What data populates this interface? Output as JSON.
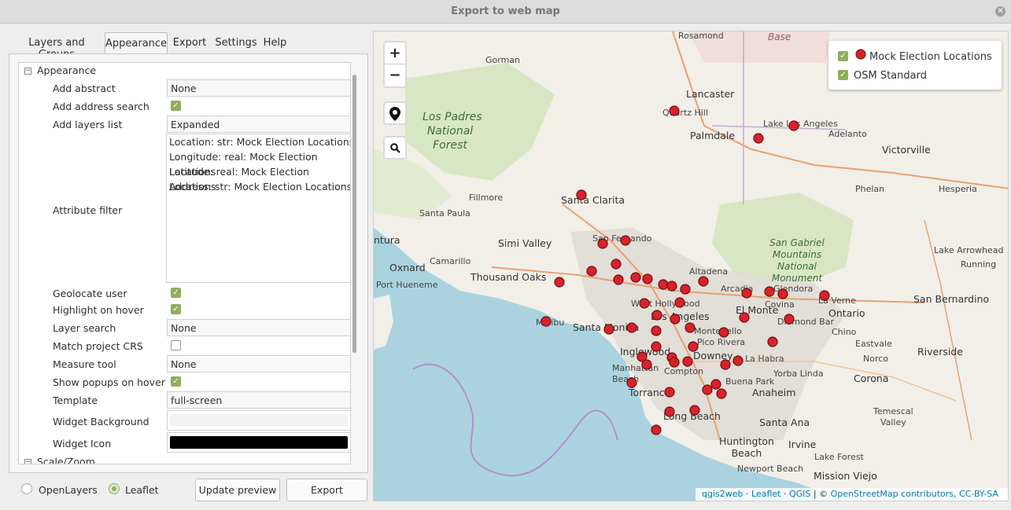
{
  "window": {
    "title": "Export to web map"
  },
  "tabs": [
    {
      "label": "Layers and Groups"
    },
    {
      "label": "Appearance"
    },
    {
      "label": "Export"
    },
    {
      "label": "Settings"
    },
    {
      "label": "Help"
    }
  ],
  "appearance": {
    "group_title": "Appearance",
    "toggle_collapse": "−",
    "add_abstract": {
      "label": "Add abstract",
      "value": "None"
    },
    "add_address_search": {
      "label": "Add address search",
      "checked": true
    },
    "add_layers_list": {
      "label": "Add layers list",
      "value": "Expanded"
    },
    "attribute_filter": {
      "label": "Attribute filter",
      "items": [
        "Location: str: Mock Election Locations",
        "Longitude: real: Mock Election Locations",
        "Latitude: real: Mock Election Locations",
        "Address: str: Mock Election Locations"
      ]
    },
    "geolocate_user": {
      "label": "Geolocate user",
      "checked": true
    },
    "highlight_on_hover": {
      "label": "Highlight on hover",
      "checked": true
    },
    "layer_search": {
      "label": "Layer search",
      "value": "None"
    },
    "match_project_crs": {
      "label": "Match project CRS",
      "checked": false
    },
    "measure_tool": {
      "label": "Measure tool",
      "value": "None"
    },
    "show_popups_on_hover": {
      "label": "Show popups on hover",
      "checked": true
    },
    "template": {
      "label": "Template",
      "value": "full-screen"
    },
    "widget_background": {
      "label": "Widget Background",
      "color": "#f2f2f2"
    },
    "widget_icon": {
      "label": "Widget Icon",
      "color": "#000000"
    },
    "scale_zoom_title": "Scale/Zoom"
  },
  "bottom": {
    "openlayers": "OpenLayers",
    "leaflet": "Leaflet",
    "selected": "Leaflet",
    "update_preview": "Update preview",
    "export": "Export"
  },
  "map": {
    "zoom_in": "+",
    "zoom_out": "−",
    "legend": [
      {
        "label": "Mock Election Locations",
        "marker_color": "#d9222a"
      },
      {
        "label": "OSM Standard"
      }
    ],
    "attribution": {
      "qgis2web": "qgis2web",
      "sep1": " · ",
      "leaflet": "Leaflet",
      "sep2": " · ",
      "qgis": "QGIS",
      "sep3": " | © ",
      "osm": "OpenStreetMap contributors, CC-BY-SA"
    },
    "labels": {
      "rosamond": "Rosamond",
      "base": "Base",
      "gorman": "Gorman",
      "lancaster": "Lancaster",
      "quartz_hill": "Quartz Hill",
      "palmdale": "Palmdale",
      "lake_los_angeles": "Lake Los Angeles",
      "adelanto": "Adelanto",
      "victorville": "Victorville",
      "los_padres": "Los Padres\nNational\nForest",
      "phelan": "Phelan",
      "hesperia": "Hesperia",
      "fillmore": "Fillmore",
      "santa_clarita": "Santa Clarita",
      "santa_paula": "Santa Paula",
      "ventura": "ntura",
      "simi_valley": "Simi Valley",
      "san_fernando": "San Fernando",
      "camarillo": "Camarillo",
      "oxnard": "Oxnard",
      "thousand_oaks": "Thousand Oaks",
      "port_hueneme": "Port Hueneme",
      "altadena": "Altadena",
      "san_gabriel": "San Gabriel\nMountains\nNational\nMonument",
      "lake_arrowhead": "Lake Arrowhead",
      "running": "Running",
      "arcadia": "Arcadia",
      "glendora": "Glendora",
      "covina": "Covina",
      "la_verne": "La Verne",
      "san_bernardino": "San Bernardino",
      "west_hollywood": "West Hollywood",
      "los_angeles": "Los Angeles",
      "el_monte": "El Monte",
      "ontario": "Ontario",
      "malibu": "Malibu",
      "santa_monica": "Santa Monica",
      "montebello": "Montebello",
      "diamond_bar": "Diamond Bar",
      "chino": "Chino",
      "pico_rivera": "Pico Rivera",
      "eastvale": "Eastvale",
      "inglewood": "Inglewood",
      "downey": "Downey",
      "la_habra": "La Habra",
      "norco": "Norco",
      "riverside": "Riverside",
      "manhattan_beach": "Manhattan\nBeach",
      "compton": "Compton",
      "yorba_linda": "Yorba Linda",
      "buena_park": "Buena Park",
      "corona": "Corona",
      "torrance": "Torrance",
      "anaheim": "Anaheim",
      "long_beach": "Long Beach",
      "temescal_valley": "Temescal\nValley",
      "santa_ana": "Santa Ana",
      "huntington_beach": "Huntington\nBeach",
      "irvine": "Irvine",
      "lake_forest": "Lake Forest",
      "newport_beach": "Newport Beach",
      "mission_viejo": "Mission Viejo"
    }
  }
}
